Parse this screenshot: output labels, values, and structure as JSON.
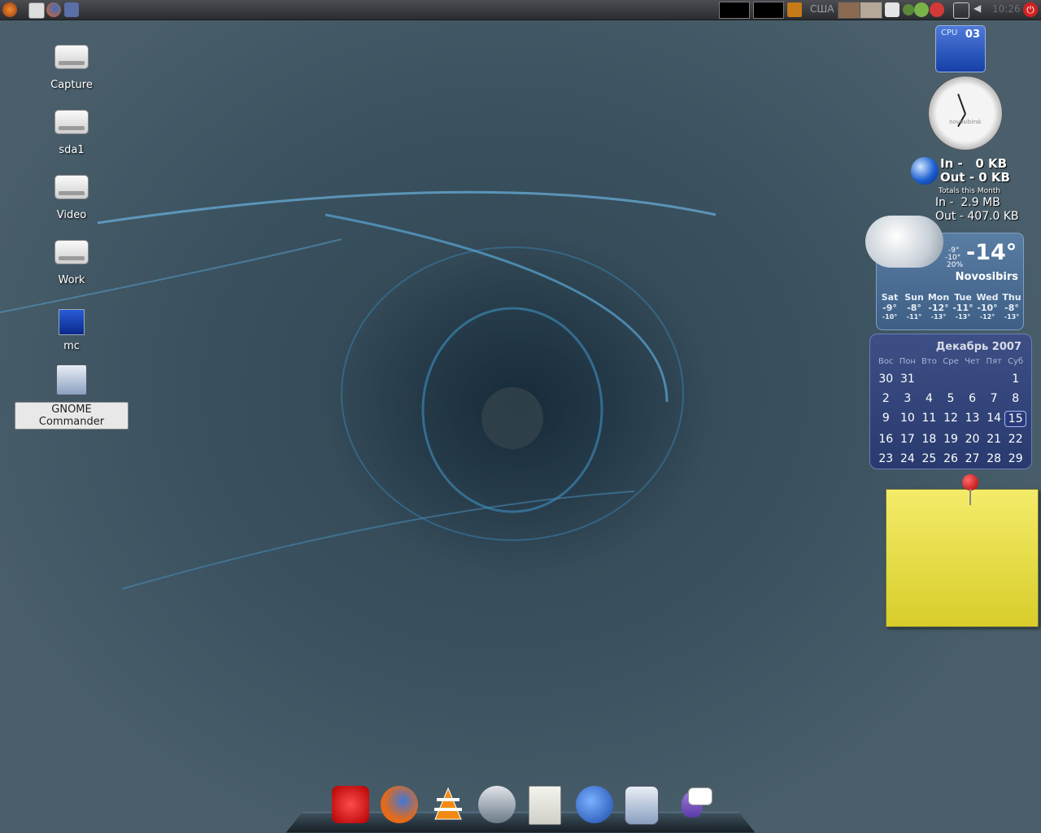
{
  "topbar": {
    "keyboard_layout": "США",
    "clock": "10:26"
  },
  "desktop_icons": [
    {
      "label": "Capture"
    },
    {
      "label": "sda1"
    },
    {
      "label": "Video"
    },
    {
      "label": "Work"
    },
    {
      "label": "mc"
    },
    {
      "label": "GNOME Commander"
    }
  ],
  "cpu_widget": {
    "label": "CPU",
    "value": "03"
  },
  "clock_widget": {
    "city": "novosibirsk"
  },
  "network": {
    "in_now": "In -   0 KB",
    "out_now": "Out - 0 KB",
    "totals_label": "Totals this Month",
    "in_total": "In -  2.9 MB",
    "out_total": "Out - 407.0 KB"
  },
  "weather": {
    "temp": "-14°",
    "hi_lo_1": "-9°",
    "hi_lo_2": "-10°",
    "humidity": "20%",
    "city": "Novosibirs",
    "forecast": [
      {
        "day": "Sat",
        "hi": "-9°",
        "lo": "-10°"
      },
      {
        "day": "Sun",
        "hi": "-8°",
        "lo": "-11°"
      },
      {
        "day": "Mon",
        "hi": "-12°",
        "lo": "-13°"
      },
      {
        "day": "Tue",
        "hi": "-11°",
        "lo": "-13°"
      },
      {
        "day": "Wed",
        "hi": "-10°",
        "lo": "-12°"
      },
      {
        "day": "Thu",
        "hi": "-8°",
        "lo": "-13°"
      }
    ]
  },
  "calendar": {
    "title": "Декабрь 2007",
    "weekdays": [
      "Вос",
      "Пон",
      "Вто",
      "Сре",
      "Чет",
      "Пят",
      "Суб"
    ],
    "weeks": [
      [
        "30",
        "31",
        "",
        "",
        "",
        "",
        "1"
      ],
      [
        "2",
        "3",
        "4",
        "5",
        "6",
        "7",
        "8"
      ],
      [
        "9",
        "10",
        "11",
        "12",
        "13",
        "14",
        "15"
      ],
      [
        "16",
        "17",
        "18",
        "19",
        "20",
        "21",
        "22"
      ],
      [
        "23",
        "24",
        "25",
        "26",
        "27",
        "28",
        "29"
      ]
    ],
    "today": "15"
  },
  "dock": [
    "tv-icon",
    "firefox-icon",
    "vlc-icon",
    "media-player-icon",
    "image-viewer-icon",
    "thunderbird-icon",
    "gnome-commander-icon",
    "pidgin-icon"
  ]
}
